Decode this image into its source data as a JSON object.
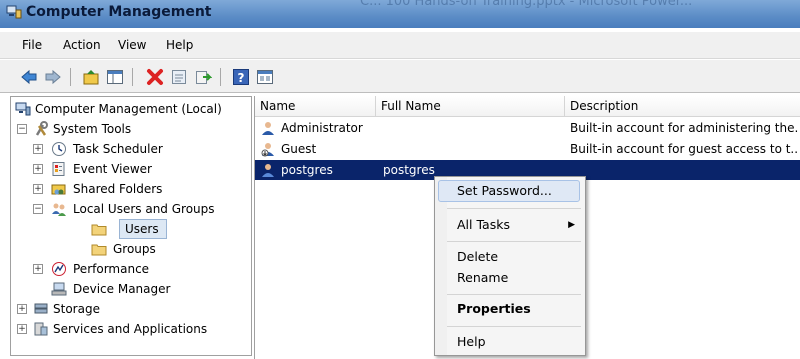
{
  "window": {
    "title": "Computer Management",
    "background_title": "C... 100 Hands-on Training.pptx - Microsoft Power..."
  },
  "menu": [
    "File",
    "Action",
    "View",
    "Help"
  ],
  "toolbar": {
    "icons": [
      "back-arrow-icon",
      "forward-arrow-icon",
      "up-folder-icon",
      "show-hide-tree-icon",
      "delete-icon",
      "properties-icon",
      "export-icon",
      "help-icon",
      "console-icon"
    ]
  },
  "tree": {
    "root": "Computer Management (Local)",
    "system_tools": "System Tools",
    "task_scheduler": "Task Scheduler",
    "event_viewer": "Event Viewer",
    "shared_folders": "Shared Folders",
    "local_users_groups": "Local Users and Groups",
    "users": "Users",
    "groups": "Groups",
    "performance": "Performance",
    "device_manager": "Device Manager",
    "storage": "Storage",
    "services_apps": "Services and Applications"
  },
  "list": {
    "headers": {
      "name": "Name",
      "full_name": "Full Name",
      "description": "Description"
    },
    "rows": [
      {
        "name": "Administrator",
        "full_name": "",
        "description": "Built-in account for administering the..."
      },
      {
        "name": "Guest",
        "full_name": "",
        "description": "Built-in account for guest access to t..."
      },
      {
        "name": "postgres",
        "full_name": "postgres",
        "description": ""
      }
    ]
  },
  "context_menu": {
    "set_password": "Set Password...",
    "all_tasks": "All Tasks",
    "delete": "Delete",
    "rename": "Rename",
    "properties": "Properties",
    "help": "Help"
  },
  "colors": {
    "selection": "#0a246a",
    "titlebar": "#5b8cc6",
    "highlight": "#dfe8f5"
  }
}
